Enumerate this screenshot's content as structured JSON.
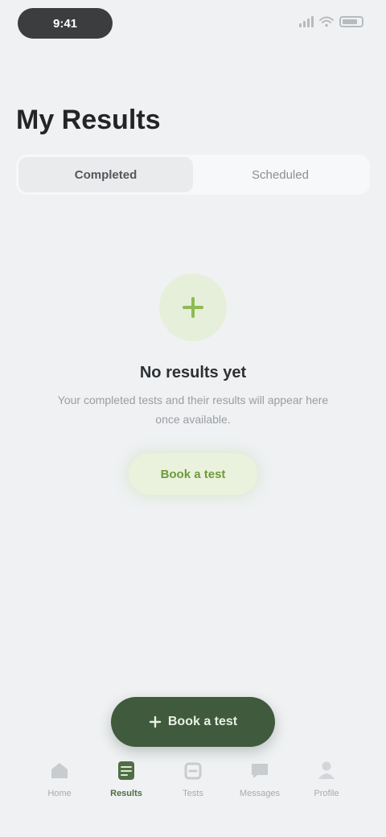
{
  "status_bar": {
    "time": "9:41",
    "icons": [
      "signal-icon",
      "wifi-icon",
      "battery-icon"
    ]
  },
  "header": {
    "title": "My Results"
  },
  "tabs": [
    {
      "label": "Completed",
      "active": true
    },
    {
      "label": "Scheduled",
      "active": false
    }
  ],
  "empty_state": {
    "icon": "plus-icon",
    "title": "No results yet",
    "description": "Your completed tests and their results will appear here once available.",
    "action_label": "Book a test"
  },
  "fab": {
    "label": "Book a test",
    "icon": "plus-icon"
  },
  "bottom_nav": [
    {
      "label": "Home",
      "icon": "home-icon",
      "active": false
    },
    {
      "label": "Results",
      "icon": "results-icon",
      "active": true
    },
    {
      "label": "Tests",
      "icon": "tests-icon",
      "active": false
    },
    {
      "label": "Messages",
      "icon": "message-icon",
      "active": false
    },
    {
      "label": "Profile",
      "icon": "profile-icon",
      "active": false
    }
  ],
  "colors": {
    "background": "#eff1f3",
    "accent_green": "#6f9a3c",
    "fab_green": "#3f5a3d"
  }
}
